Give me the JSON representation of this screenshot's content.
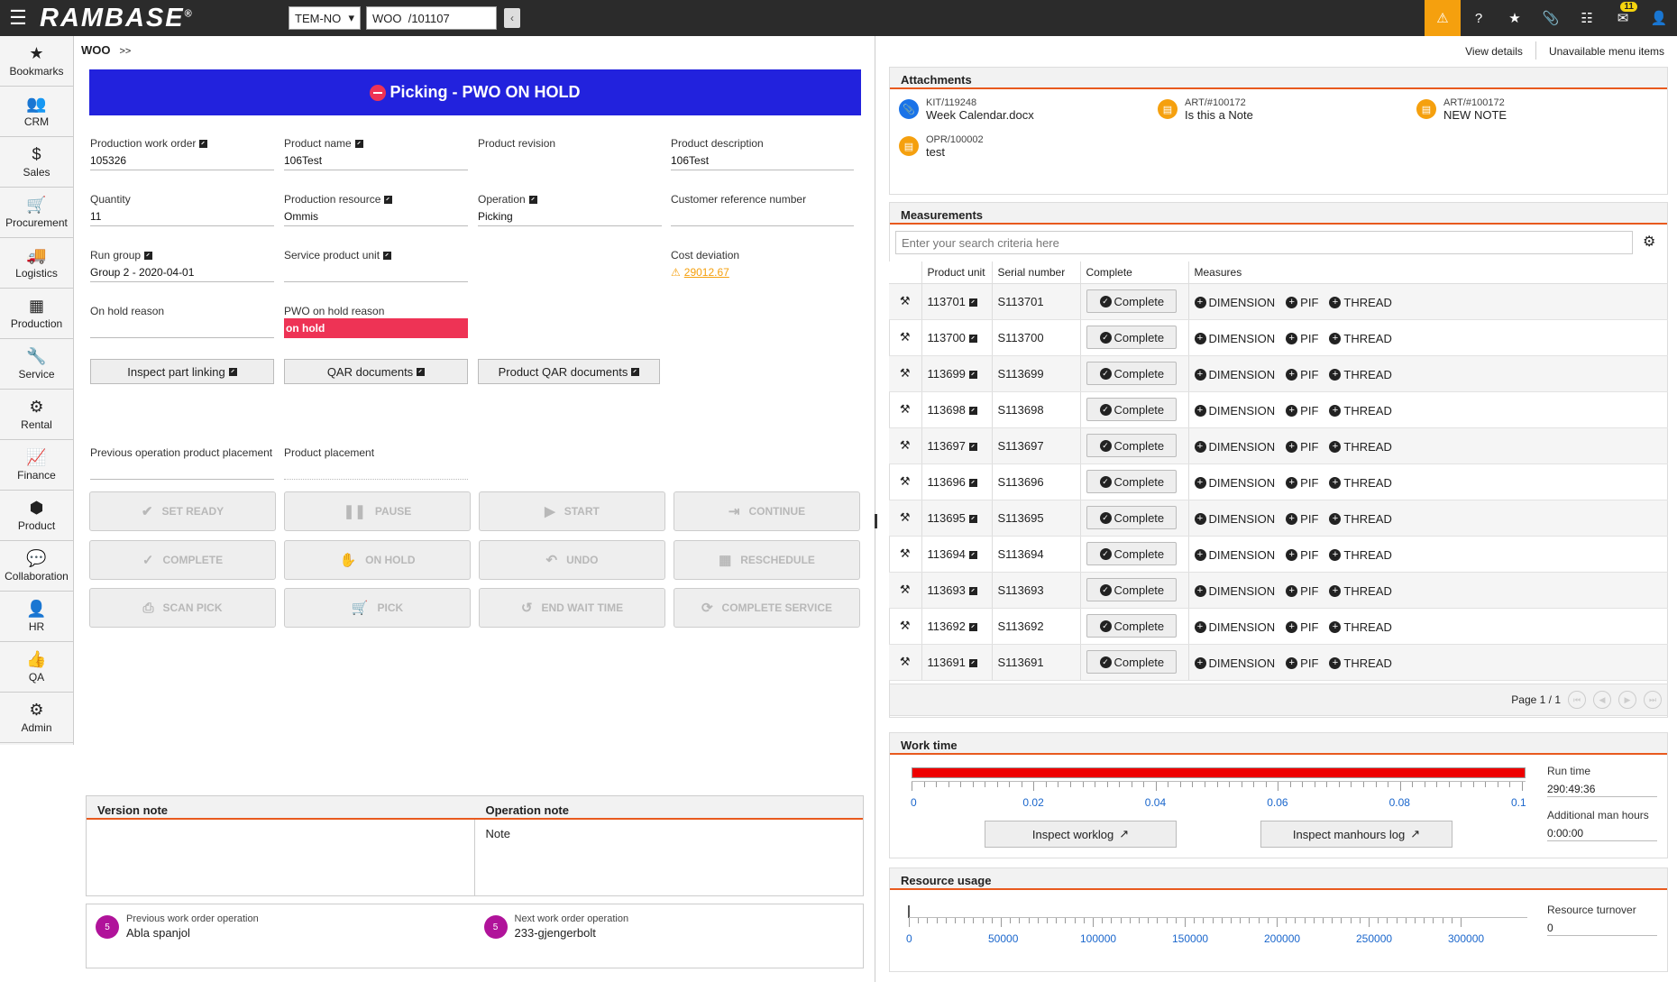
{
  "app": {
    "logo": "RAMBASE",
    "company": "TEM-NO",
    "object_ref": "WOO  /101107"
  },
  "topbar": {
    "notification_count": "11"
  },
  "colors": {
    "banner": "#2222dd",
    "accent": "#e85a1e",
    "warning": "#f5a00e",
    "alert": "#ee3355",
    "circle": "#b0139a"
  },
  "nav": [
    {
      "label": "Bookmarks",
      "icon": "star-icon",
      "glyph": "★"
    },
    {
      "label": "CRM",
      "icon": "users-icon",
      "glyph": "👥"
    },
    {
      "label": "Sales",
      "icon": "dollar-icon",
      "glyph": "$"
    },
    {
      "label": "Procurement",
      "icon": "cart-icon",
      "glyph": "🛒"
    },
    {
      "label": "Logistics",
      "icon": "truck-icon",
      "glyph": "🚚"
    },
    {
      "label": "Production",
      "icon": "cubes-icon",
      "glyph": "▦"
    },
    {
      "label": "Service",
      "icon": "wrench-icon",
      "glyph": "🔧"
    },
    {
      "label": "Rental",
      "icon": "rental-icon",
      "glyph": "⚙"
    },
    {
      "label": "Finance",
      "icon": "chart-line-icon",
      "glyph": "📈"
    },
    {
      "label": "Product",
      "icon": "box-icon",
      "glyph": "⬢"
    },
    {
      "label": "Collaboration",
      "icon": "chat-icon",
      "glyph": "💬"
    },
    {
      "label": "HR",
      "icon": "person-icon",
      "glyph": "👤"
    },
    {
      "label": "QA",
      "icon": "thumbs-up-icon",
      "glyph": "👍"
    },
    {
      "label": "Admin",
      "icon": "gear-icon",
      "glyph": "⚙"
    }
  ],
  "breadcrumb": {
    "title": "WOO",
    "arrow": ">>"
  },
  "links": {
    "view_details": "View details",
    "unavailable": "Unavailable menu items"
  },
  "banner": {
    "text": "Picking - PWO ON HOLD"
  },
  "fields": {
    "pwo": {
      "label": "Production work order",
      "value": "105326"
    },
    "product_name": {
      "label": "Product name",
      "value": "106Test"
    },
    "product_revision": {
      "label": "Product revision",
      "value": ""
    },
    "product_description": {
      "label": "Product description",
      "value": "106Test"
    },
    "quantity": {
      "label": "Quantity",
      "value": "11"
    },
    "production_resource": {
      "label": "Production resource",
      "value": "Ommis"
    },
    "operation": {
      "label": "Operation",
      "value": "Picking"
    },
    "customer_ref": {
      "label": "Customer reference number",
      "value": ""
    },
    "run_group": {
      "label": "Run group",
      "value": "Group 2 - 2020-04-01"
    },
    "service_pu": {
      "label": "Service product unit",
      "value": ""
    },
    "cost_deviation": {
      "label": "Cost deviation",
      "value": "29012.67"
    },
    "on_hold_reason": {
      "label": "On hold reason",
      "value": ""
    },
    "pwo_on_hold_reason": {
      "label": "PWO on hold reason",
      "value": "on hold"
    },
    "prev_placement": {
      "label": "Previous operation product placement",
      "value": ""
    },
    "product_placement": {
      "label": "Product placement",
      "value": ""
    }
  },
  "doc_buttons": {
    "inspect": "Inspect part linking",
    "qar": "QAR documents",
    "product_qar": "Product QAR documents"
  },
  "actions": {
    "set_ready": "SET READY",
    "pause": "PAUSE",
    "start": "START",
    "continue": "CONTINUE",
    "complete": "COMPLETE",
    "on_hold": "ON HOLD",
    "undo": "UNDO",
    "reschedule": "RESCHEDULE",
    "scan_pick": "SCAN PICK",
    "pick": "PICK",
    "end_wait": "END WAIT TIME",
    "complete_service": "COMPLETE SERVICE"
  },
  "notes": {
    "version_header": "Version note",
    "operation_header": "Operation note",
    "version_body": "",
    "operation_body": "Note"
  },
  "wo_ops": {
    "prev": {
      "num": "5",
      "label": "Previous work order operation",
      "value": "Abla spanjol"
    },
    "next": {
      "num": "5",
      "label": "Next work order operation",
      "value": "233-gjengerbolt"
    }
  },
  "attachments": {
    "title": "Attachments",
    "items": [
      {
        "id": "KIT/119248",
        "name": "Week Calendar.docx"
      },
      {
        "id": "ART/#100172",
        "name": "Is this a Note"
      },
      {
        "id": "ART/#100172",
        "name": "NEW NOTE"
      },
      {
        "id": "OPR/100002",
        "name": "test"
      }
    ]
  },
  "measurements": {
    "title": "Measurements",
    "search_placeholder": "Enter your search criteria here",
    "columns": [
      "Product unit",
      "Serial number",
      "Complete",
      "Measures"
    ],
    "complete_label": "Complete",
    "measures": [
      "DIMENSION",
      "PIF",
      "THREAD"
    ],
    "rows": [
      {
        "pu": "113701",
        "sn": "S113701"
      },
      {
        "pu": "113700",
        "sn": "S113700"
      },
      {
        "pu": "113699",
        "sn": "S113699"
      },
      {
        "pu": "113698",
        "sn": "S113698"
      },
      {
        "pu": "113697",
        "sn": "S113697"
      },
      {
        "pu": "113696",
        "sn": "S113696"
      },
      {
        "pu": "113695",
        "sn": "S113695"
      },
      {
        "pu": "113694",
        "sn": "S113694"
      },
      {
        "pu": "113693",
        "sn": "S113693"
      },
      {
        "pu": "113692",
        "sn": "S113692"
      },
      {
        "pu": "113691",
        "sn": "S113691"
      }
    ],
    "page": "Page 1 / 1"
  },
  "work_time": {
    "title": "Work time",
    "ticks": [
      "0",
      "0.02",
      "0.04",
      "0.06",
      "0.08",
      "0.1"
    ],
    "run_time_label": "Run time",
    "run_time": "290:49:36",
    "man_hours_label": "Additional man hours",
    "man_hours": "0:00:00",
    "worklog_btn": "Inspect worklog",
    "manhours_btn": "Inspect manhours log"
  },
  "resource_usage": {
    "title": "Resource usage",
    "ticks": [
      "0",
      "50000",
      "100000",
      "150000",
      "200000",
      "250000",
      "300000"
    ],
    "turnover_label": "Resource turnover",
    "turnover": "0"
  }
}
